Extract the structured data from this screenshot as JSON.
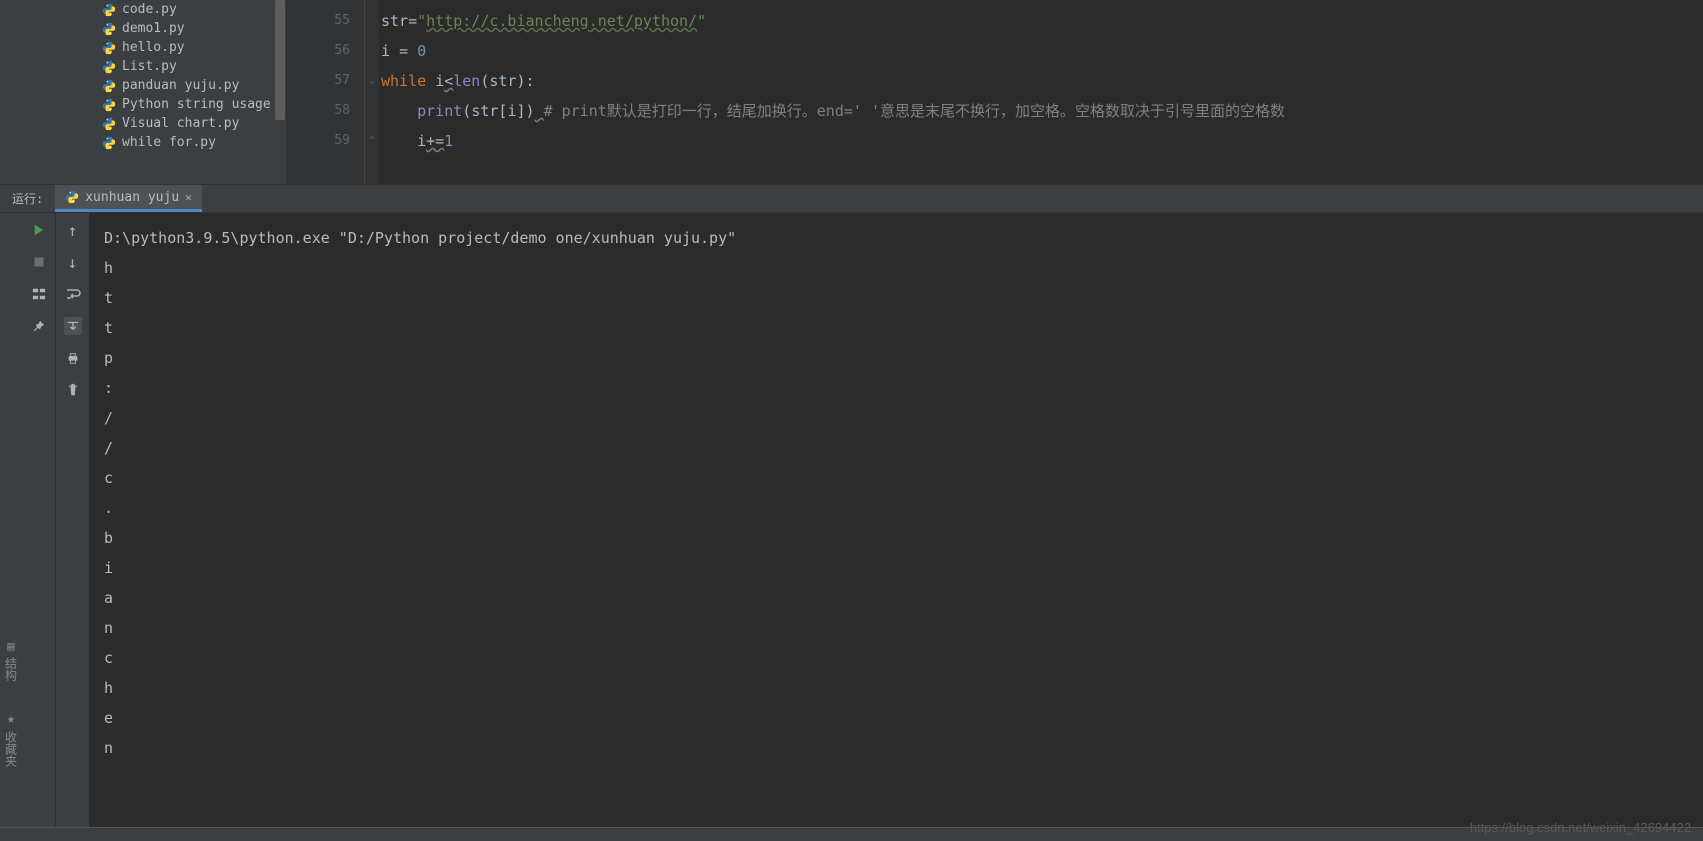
{
  "projectTree": {
    "files": [
      "code.py",
      "demo1.py",
      "hello.py",
      "List.py",
      "panduan yuju.py",
      "Python string usage method",
      "Visual chart.py",
      "while for.py"
    ]
  },
  "editor": {
    "lines": [
      {
        "num": "55",
        "fold": "",
        "tokens": [
          {
            "cls": "var",
            "t": "str"
          },
          {
            "cls": "op",
            "t": "="
          },
          {
            "cls": "str-q",
            "t": "\""
          },
          {
            "cls": "str",
            "t": "http://c.biancheng.net/python/"
          },
          {
            "cls": "str-q",
            "t": "\""
          }
        ]
      },
      {
        "num": "56",
        "fold": "",
        "tokens": [
          {
            "cls": "var",
            "t": "i "
          },
          {
            "cls": "op",
            "t": "= "
          },
          {
            "cls": "num",
            "t": "0"
          }
        ]
      },
      {
        "num": "57",
        "fold": "⌄",
        "tokens": [
          {
            "cls": "kw",
            "t": "while "
          },
          {
            "cls": "var",
            "t": "i"
          },
          {
            "cls": "op wavy",
            "t": "<"
          },
          {
            "cls": "builtin",
            "t": "len"
          },
          {
            "cls": "op",
            "t": "("
          },
          {
            "cls": "var",
            "t": "str"
          },
          {
            "cls": "op",
            "t": "):"
          }
        ]
      },
      {
        "num": "58",
        "fold": "",
        "tokens": [
          {
            "cls": "var",
            "t": "    "
          },
          {
            "cls": "builtin",
            "t": "print"
          },
          {
            "cls": "op",
            "t": "("
          },
          {
            "cls": "var",
            "t": "str"
          },
          {
            "cls": "op",
            "t": "["
          },
          {
            "cls": "var",
            "t": "i"
          },
          {
            "cls": "op",
            "t": "])"
          },
          {
            "cls": "var wavy",
            "t": " "
          },
          {
            "cls": "comment",
            "t": "# print默认是打印一行，结尾加换行。end=' '意思是末尾不换行，加空格。空格数取决于引号里面的空格数"
          }
        ]
      },
      {
        "num": "59",
        "fold": "⌃",
        "tokens": [
          {
            "cls": "var",
            "t": "    "
          },
          {
            "cls": "var",
            "t": "i"
          },
          {
            "cls": "op wavy",
            "t": "+="
          },
          {
            "cls": "num",
            "t": "1"
          }
        ]
      }
    ]
  },
  "runPanel": {
    "label": "运行:",
    "tabName": "xunhuan yuju"
  },
  "console": {
    "lines": [
      "D:\\python3.9.5\\python.exe \"D:/Python project/demo one/xunhuan yuju.py\"",
      "h",
      "t",
      "t",
      "p",
      ":",
      "/",
      "/",
      "c",
      ".",
      "b",
      "i",
      "a",
      "n",
      "c",
      "h",
      "e",
      "n"
    ]
  },
  "leftStrip": {
    "structure": "结构",
    "favorites": "收藏夹"
  },
  "watermark": "https://blog.csdn.net/weixin_42694422"
}
